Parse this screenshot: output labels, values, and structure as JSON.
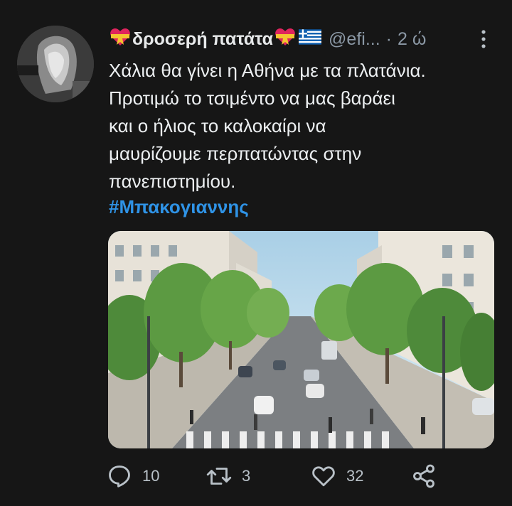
{
  "tweet": {
    "display_name": "δροσερή πατάτα",
    "handle": "@efi...",
    "separator": "·",
    "time": "2 ώ",
    "text": "Χάλια θα γίνει η Αθήνα με τα πλατάνια.\nΠροτιμώ το τσιμέντο να μας βαράει\nκαι ο ήλιος το καλοκαίρι να\nμαυρίζουμε περπατώντας στην\nπανεπιστημίου.",
    "hashtag": "#Μπακογιαννης",
    "icons": {
      "name_emoji_left": "heart-ribbon-emoji-icon",
      "name_emoji_right": "heart-ribbon-emoji-icon",
      "flag": "greek-flag-icon",
      "more": "more-vertical-icon"
    }
  },
  "actions": {
    "reply_count": "10",
    "retweet_count": "3",
    "like_count": "32"
  },
  "colors": {
    "background": "#161616",
    "text": "#e7e9ea",
    "secondary": "#8b98a5",
    "hashtag": "#2f93e6"
  }
}
